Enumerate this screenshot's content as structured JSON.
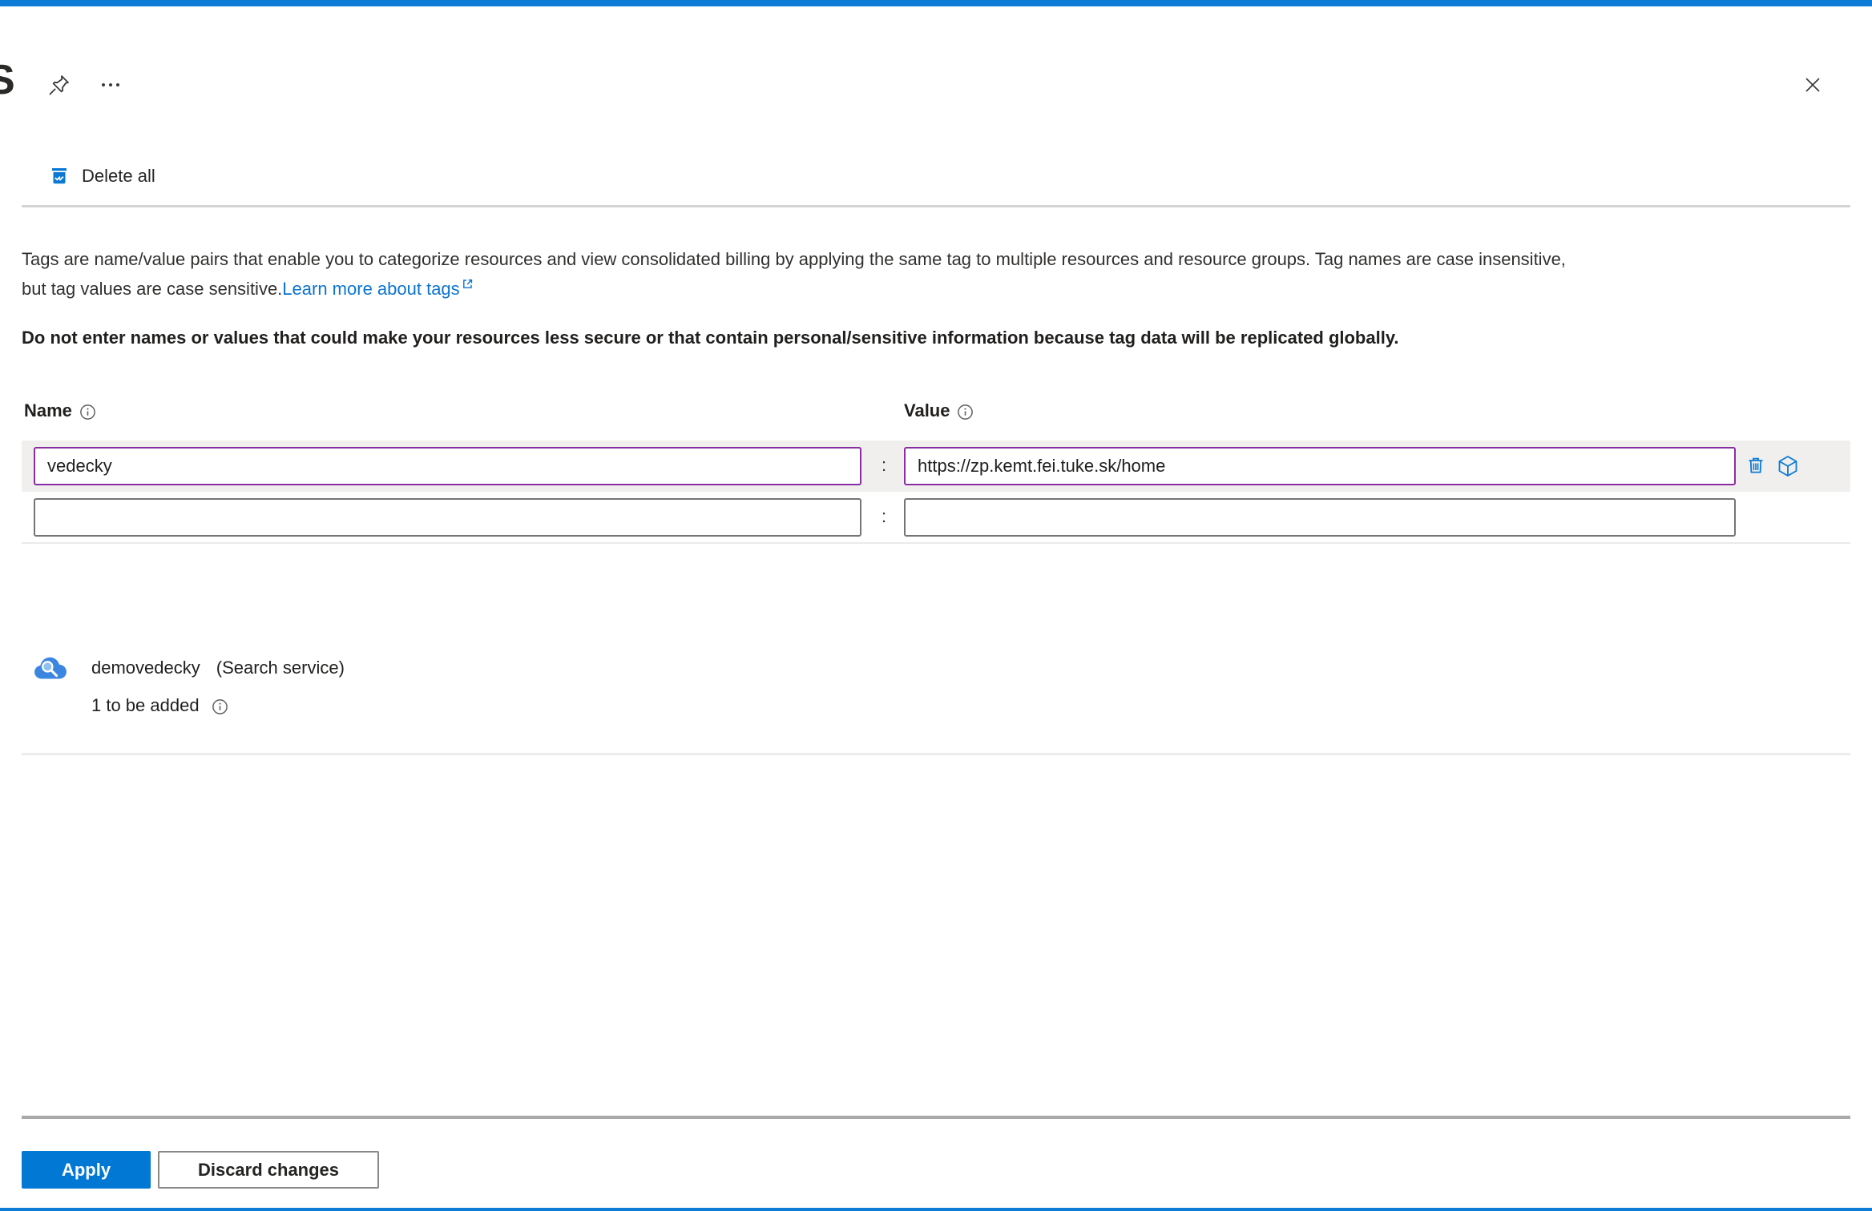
{
  "window": {
    "partial_title": "S"
  },
  "colors": {
    "accent_blue": "#0d7cd6",
    "link_blue": "#0078d4",
    "edited_input_purple": "#8a2da5",
    "row_highlight_gray": "#f0efed",
    "apply_button_blue": "#0078d4"
  },
  "toolbar": {
    "delete_all_label": "Delete all"
  },
  "intro": {
    "line1": "Tags are name/value pairs that enable you to categorize resources and view consolidated billing by applying the same tag to multiple resources and resource groups. Tag names are case insensitive,",
    "line2": "but tag values are case sensitive.",
    "learn_more_label": "Learn more about tags"
  },
  "warning": "Do not enter names or values that could make your resources less secure or that contain personal/sensitive information because tag data will be replicated globally.",
  "tag_editor": {
    "name_header": "Name",
    "value_header": "Value",
    "separator": ":",
    "rows": [
      {
        "name": "vedecky",
        "value": "https://zp.kemt.fei.tuke.sk/home"
      },
      {
        "name": "",
        "value": ""
      }
    ]
  },
  "resource": {
    "name": "demovedecky",
    "type_label": "(Search service)",
    "pending_label": "1 to be added"
  },
  "footer": {
    "apply_label": "Apply",
    "discard_label": "Discard changes"
  }
}
